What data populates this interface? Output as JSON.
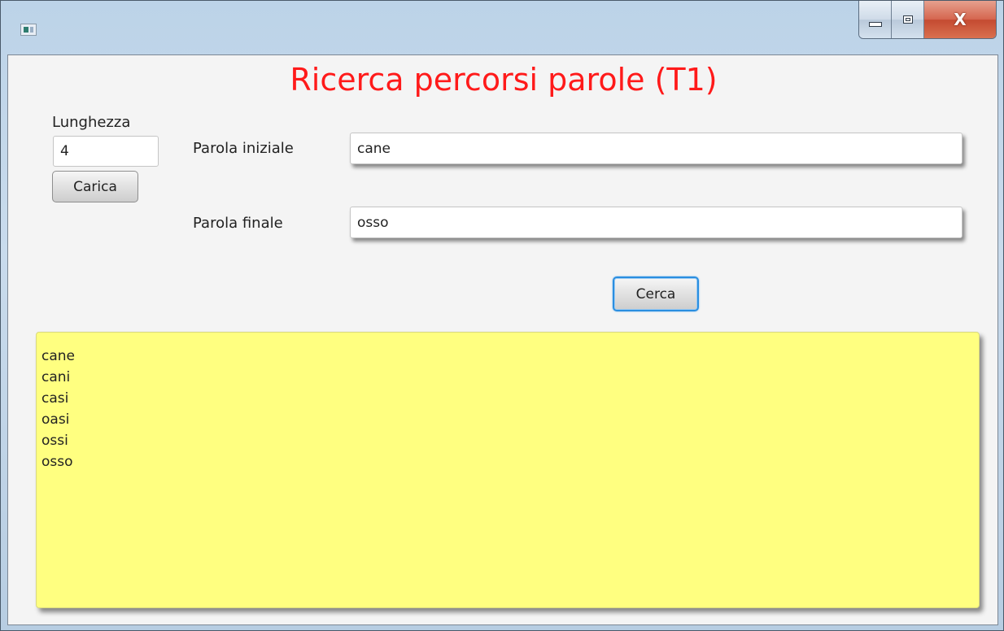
{
  "window": {
    "title": "",
    "controls": {
      "minimize_icon": "minimize-icon",
      "maximize_icon": "maximize-icon",
      "close_icon": "close-icon",
      "close_glyph": "X"
    }
  },
  "heading": "Ricerca percorsi parole (T1)",
  "length": {
    "label": "Lunghezza",
    "value": "4",
    "load_button": "Carica"
  },
  "start_word": {
    "label": "Parola iniziale",
    "value": "cane"
  },
  "end_word": {
    "label": "Parola finale",
    "value": "osso"
  },
  "search_button": "Cerca",
  "results": {
    "lines": [
      "cane",
      "cani",
      "casi",
      "oasi",
      "ossi",
      "osso"
    ]
  },
  "colors": {
    "heading": "#ff1a1a",
    "result_background": "#ffff80",
    "focus_border": "#2a8ee0"
  }
}
